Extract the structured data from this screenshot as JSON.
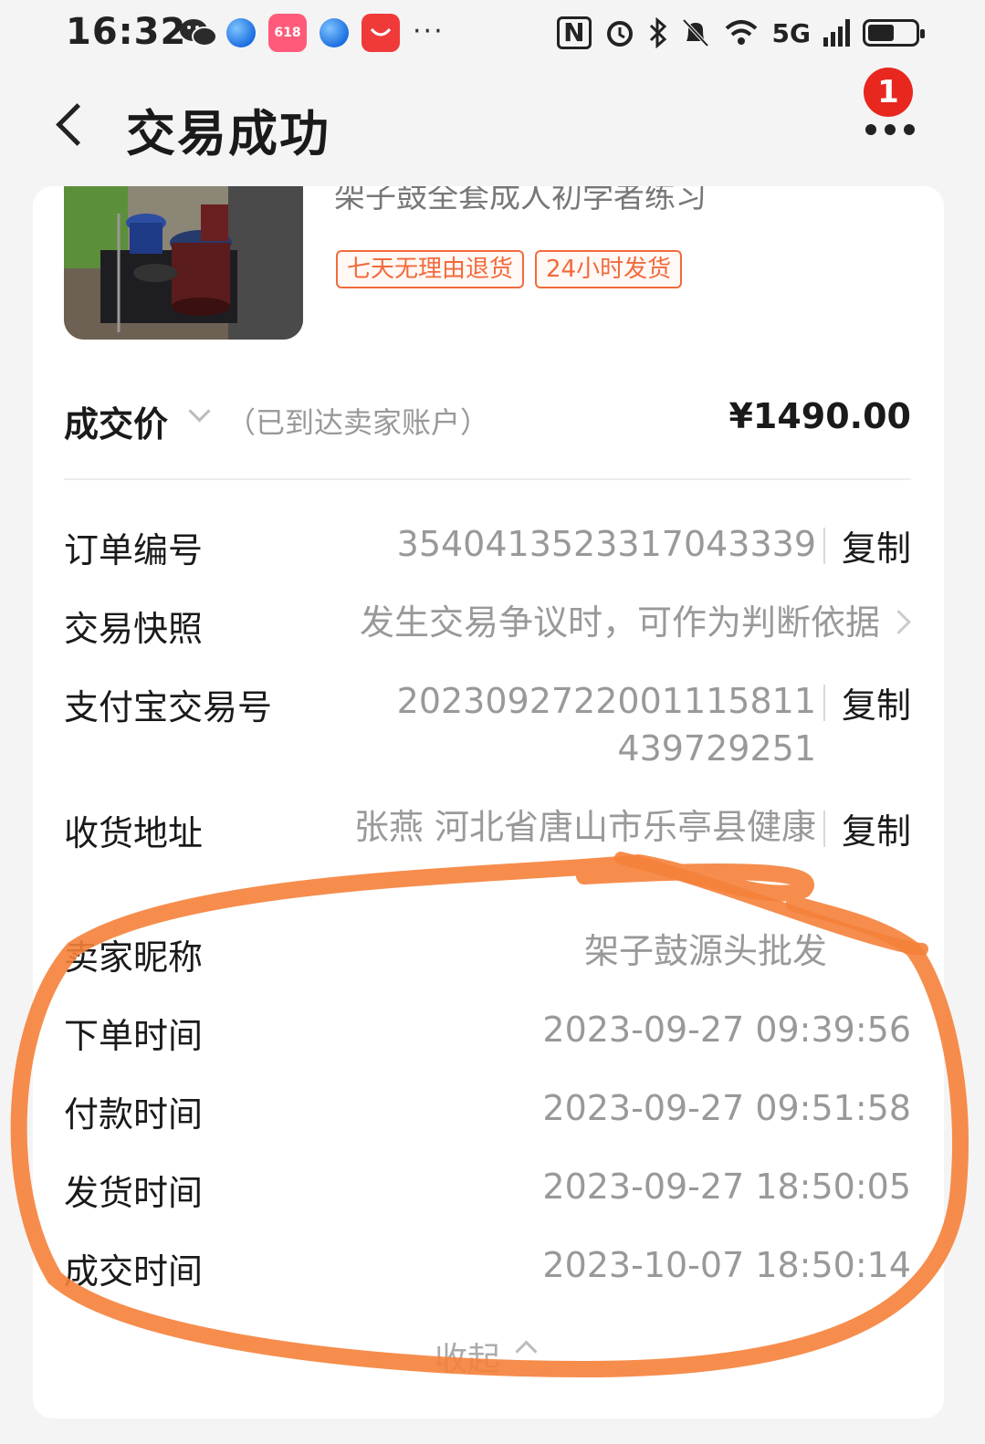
{
  "status_bar": {
    "time": "16:32",
    "app_icons": [
      "wechat-icon",
      "browser-icon",
      "shopping-618-icon",
      "browser-icon",
      "huawei-app-icon"
    ],
    "more": "···",
    "signal_label": "5G",
    "battery_level": 0.55
  },
  "header": {
    "title": "交易成功",
    "notification_count": "1"
  },
  "product": {
    "title_cut": "架子鼓全套成人初学者练习",
    "tags": [
      "七天无理由退货",
      "24小时发货"
    ]
  },
  "price": {
    "label": "成交价",
    "note": "（已到达卖家账户）",
    "value": "¥1490.00"
  },
  "details": {
    "copy_label": "复制",
    "order_no": {
      "label": "订单编号",
      "value": "3540413523317043339"
    },
    "snapshot": {
      "label": "交易快照",
      "value": "发生交易争议时，可作为判断依据"
    },
    "alipay_no": {
      "label": "支付宝交易号",
      "line1": "20230927220011158​11",
      "line2": "439729251"
    },
    "address": {
      "label": "收货地址",
      "value": "张燕 河北省唐山市乐亭县健康"
    },
    "seller": {
      "label": "卖家昵称",
      "value": "架子鼓源头批发"
    },
    "order_time": {
      "label": "下单时间",
      "value": "2023-09-27 09:39:56"
    },
    "pay_time": {
      "label": "付款时间",
      "value": "2023-09-27 09:51:58"
    },
    "ship_time": {
      "label": "发货时间",
      "value": "2023-09-27 18:50:05"
    },
    "deal_time": {
      "label": "成交时间",
      "value": "2023-10-07 18:50:14"
    }
  },
  "collapse_label": "收起",
  "annotation_color": "#f5813a"
}
